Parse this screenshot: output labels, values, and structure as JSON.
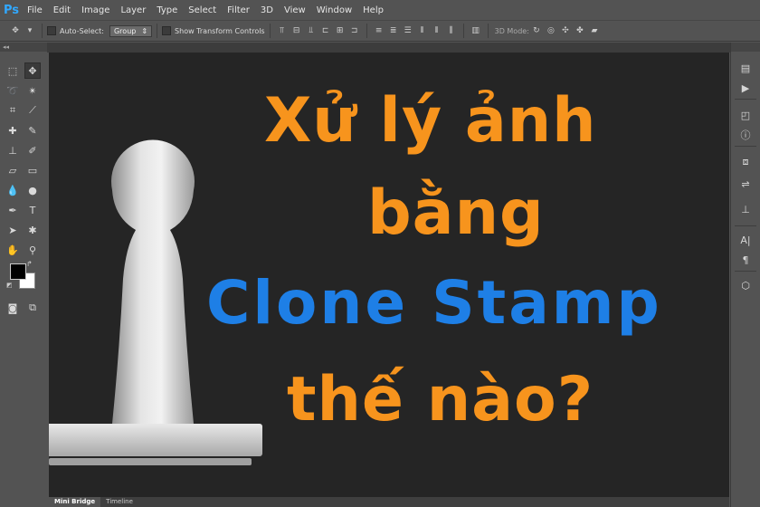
{
  "app": {
    "logo": "Ps"
  },
  "menu": [
    "File",
    "Edit",
    "Image",
    "Layer",
    "Type",
    "Select",
    "Filter",
    "3D",
    "View",
    "Window",
    "Help"
  ],
  "options": {
    "auto_select_label": "Auto-Select:",
    "group_value": "Group",
    "show_transform_label": "Show Transform Controls",
    "mode_3d_label": "3D Mode:"
  },
  "canvas_text": {
    "line1": "Xử lý ảnh",
    "line2": "bằng",
    "line3": "Clone Stamp",
    "line4": "thế nào?"
  },
  "colors": {
    "orange": "#f7941d",
    "blue": "#1e7fe6",
    "canvas": "#252525"
  },
  "bottom_tabs": [
    "Mini Bridge",
    "Timeline"
  ]
}
